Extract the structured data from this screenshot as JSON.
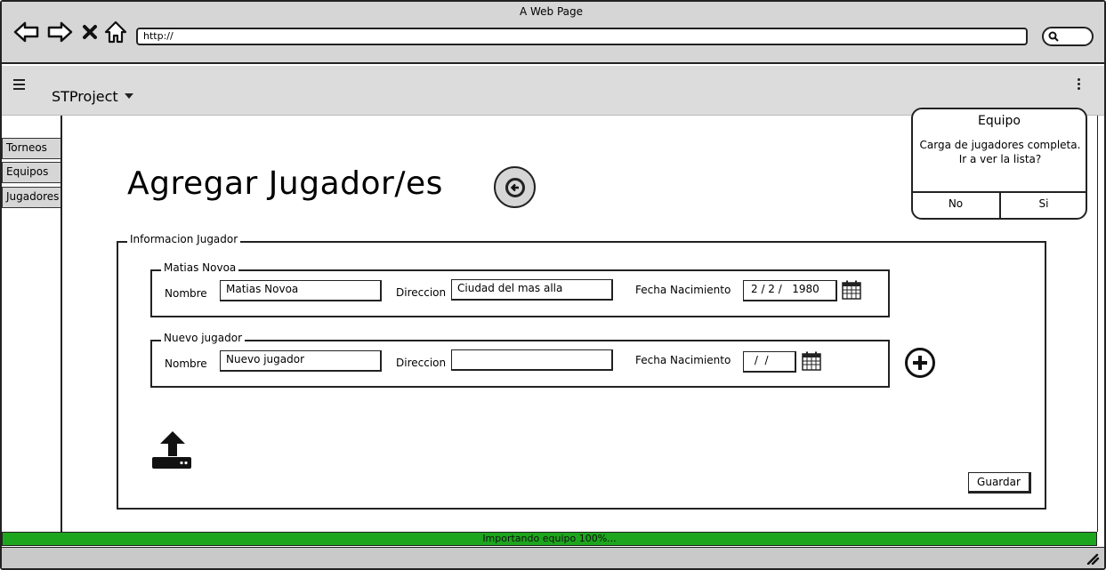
{
  "browser": {
    "window_title": "A Web Page",
    "url": "http://"
  },
  "app": {
    "project_name": "STProject"
  },
  "sidebar": {
    "items": [
      {
        "label": "Torneos"
      },
      {
        "label": "Equipos"
      },
      {
        "label": "Jugadores"
      }
    ]
  },
  "page": {
    "title": "Agregar Jugador/es"
  },
  "form": {
    "legend": "Informacion Jugador",
    "players": [
      {
        "legend": "Matias Novoa",
        "nombre_label": "Nombre",
        "nombre_value": "Matias Novoa",
        "direccion_label": "Direccion",
        "direccion_value": "Ciudad del mas alla",
        "fecha_label": "Fecha Nacimiento",
        "fecha_value": "2 / 2 /   1980"
      },
      {
        "legend": "Nuevo jugador",
        "nombre_label": "Nombre",
        "nombre_value": "Nuevo jugador",
        "direccion_label": "Direccion",
        "direccion_value": "",
        "fecha_label": "Fecha Nacimiento",
        "fecha_value": " /  /"
      }
    ],
    "save_label": "Guardar"
  },
  "dialog": {
    "title": "Equipo",
    "message": "Carga de jugadores completa.\nIr a ver la lista?",
    "no_label": "No",
    "yes_label": "Si"
  },
  "status": {
    "text": "Importando equipo 100%...",
    "progress": 1.0,
    "color": "#1da51d"
  },
  "icons": [
    "back-icon",
    "forward-icon",
    "close-icon",
    "home-icon",
    "search-icon",
    "menu-icon",
    "caret-down-icon",
    "kebab-icon",
    "back-circle-icon",
    "calendar-icon",
    "plus-circle-icon",
    "upload-icon",
    "resize-icon"
  ]
}
